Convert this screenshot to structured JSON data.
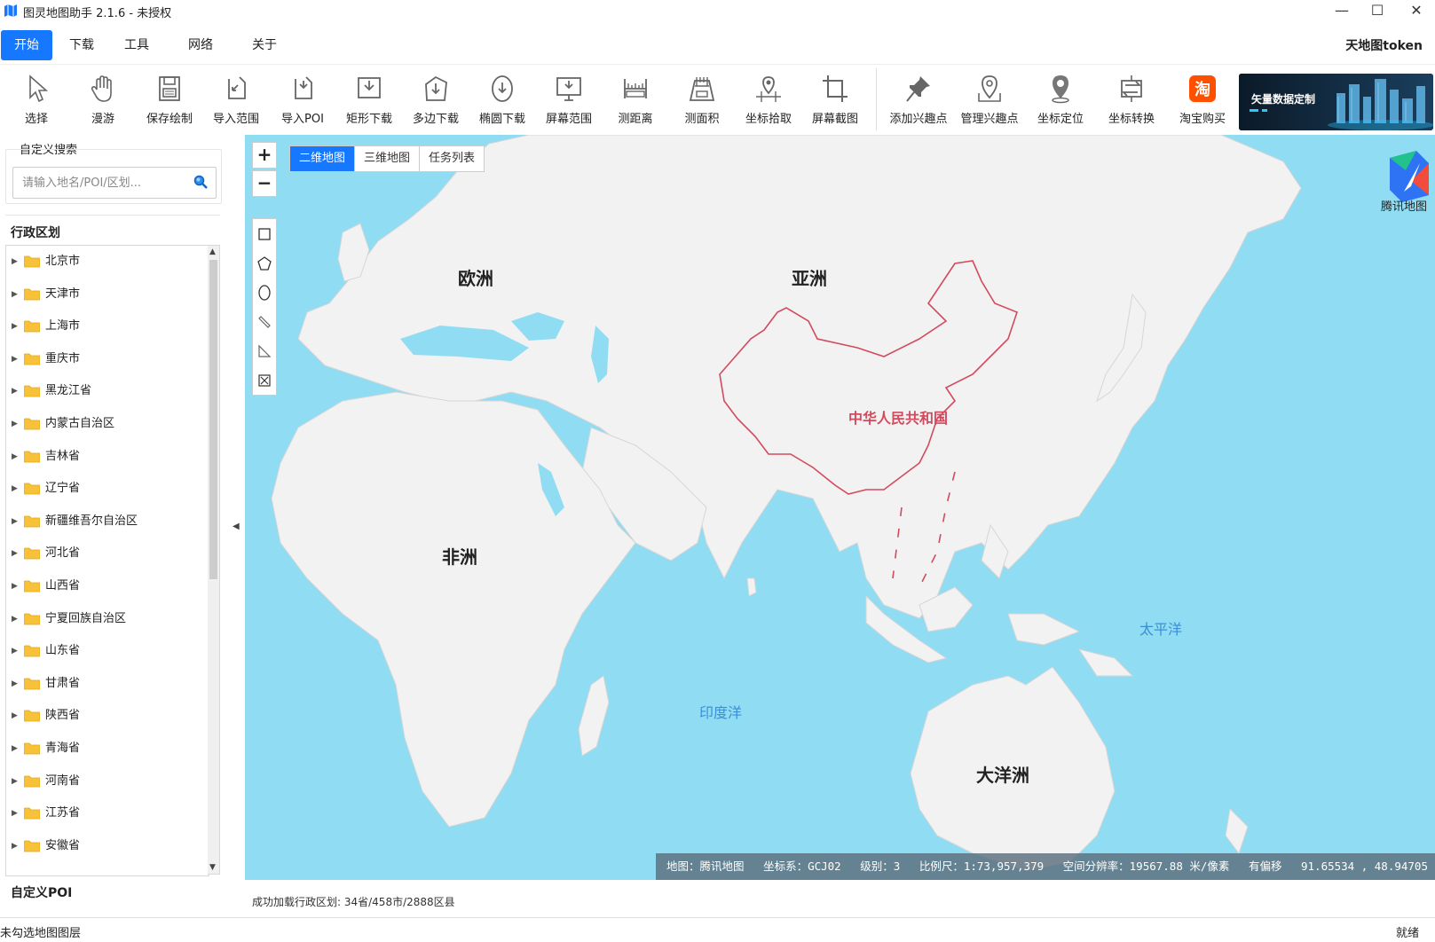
{
  "app": {
    "title": "图灵地图助手  2.1.6 - 未授权",
    "window_controls": [
      "—",
      "☐",
      "✕"
    ]
  },
  "menu": {
    "items": [
      "开始",
      "下载",
      "工具",
      "网络",
      "关于"
    ],
    "active_index": 0,
    "token_label": "天地图token"
  },
  "toolbar": {
    "tools": [
      {
        "label": "选择",
        "icon": "cursor-icon"
      },
      {
        "label": "漫游",
        "icon": "hand-icon"
      },
      {
        "label": "保存绘制",
        "icon": "save-icon"
      },
      {
        "label": "导入范围",
        "icon": "import-range-icon"
      },
      {
        "label": "导入POI",
        "icon": "import-poi-icon"
      },
      {
        "label": "矩形下载",
        "icon": "rect-download-icon"
      },
      {
        "label": "多边下载",
        "icon": "polygon-download-icon"
      },
      {
        "label": "椭圆下载",
        "icon": "ellipse-download-icon"
      },
      {
        "label": "屏幕范围",
        "icon": "screen-range-icon"
      },
      {
        "label": "测距离",
        "icon": "ruler-icon"
      },
      {
        "label": "测面积",
        "icon": "area-icon"
      },
      {
        "label": "坐标拾取",
        "icon": "pick-coordinate-icon"
      },
      {
        "label": "屏幕截图",
        "icon": "crop-icon"
      },
      {
        "label": "添加兴趣点",
        "icon": "pin-icon"
      },
      {
        "label": "管理兴趣点",
        "icon": "manage-poi-icon"
      },
      {
        "label": "坐标定位",
        "icon": "location-icon"
      },
      {
        "label": "坐标转换",
        "icon": "convert-icon"
      },
      {
        "label": "淘宝购买",
        "icon": "taobao-icon"
      }
    ],
    "ad_text": "矢量数据定制"
  },
  "left_panel": {
    "search_label": "自定义搜索",
    "search_placeholder": "请输入地名/POI/区划...",
    "admin_title": "行政区划",
    "provinces": [
      "北京市",
      "天津市",
      "上海市",
      "重庆市",
      "黑龙江省",
      "内蒙古自治区",
      "吉林省",
      "辽宁省",
      "新疆维吾尔自治区",
      "河北省",
      "山西省",
      "宁夏回族自治区",
      "山东省",
      "甘肃省",
      "陕西省",
      "青海省",
      "河南省",
      "江苏省",
      "安徽省"
    ],
    "poi_title": "自定义POI"
  },
  "map": {
    "tabs": [
      "二维地图",
      "三维地图",
      "任务列表"
    ],
    "active_tab": 0,
    "zoom_in": "+",
    "zoom_out": "−",
    "labels": {
      "europe": "欧洲",
      "asia": "亚洲",
      "africa": "非洲",
      "oceania": "大洋洲",
      "china": "中华人民共和国",
      "pacific": "太平洋",
      "indian_ocean": "印度洋"
    },
    "provider_logo_label": "腾讯地图",
    "status": {
      "map": "地图：腾讯地图",
      "crs": "坐标系：GCJ02",
      "level": "级别：3",
      "scale": "比例尺：1:73,957,379",
      "resolution": "空间分辨率：19567.88 米/像素",
      "offset": "有偏移",
      "coords": "91.65534 , 48.94705"
    }
  },
  "load_message": "成功加载行政区划: 34省/458市/2888区县",
  "statusbar": {
    "left": "未勾选地图图层",
    "right": "就绪"
  },
  "colors": {
    "accent": "#1677ff",
    "ocean": "#8fdcf3",
    "land": "#f2f2f2",
    "china_border": "#d24a5e"
  }
}
